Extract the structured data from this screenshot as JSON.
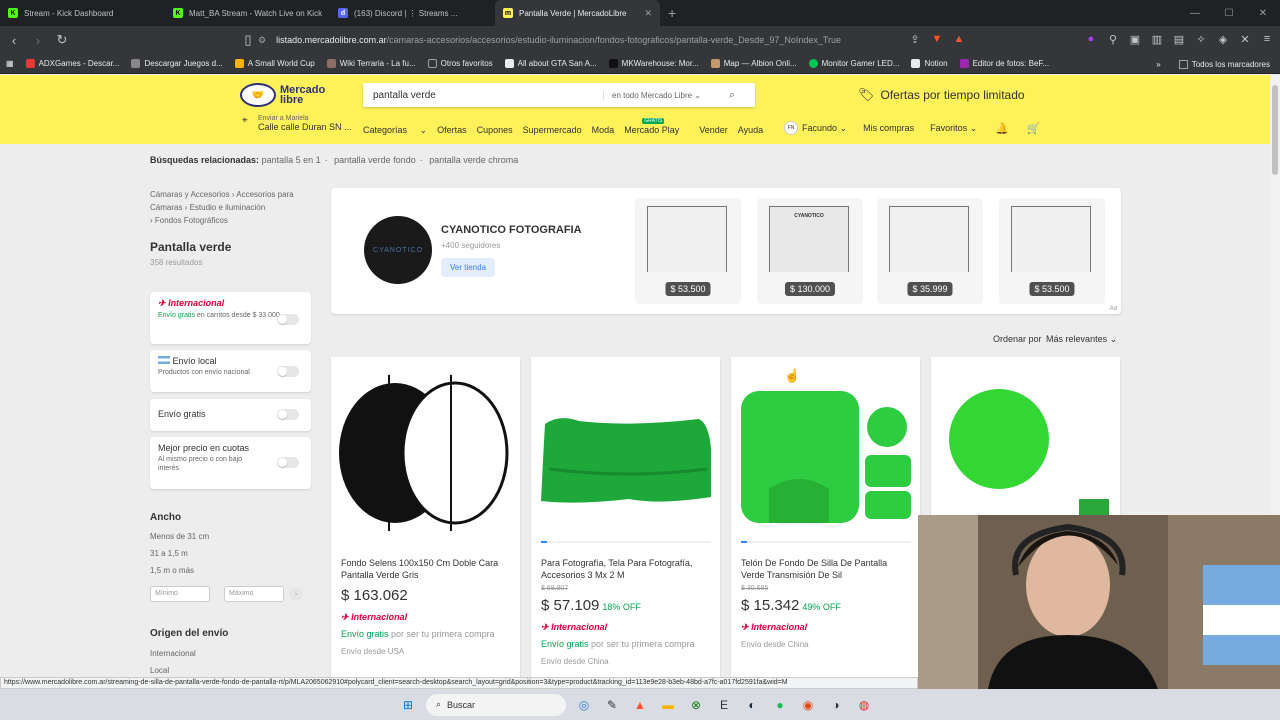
{
  "browser": {
    "tabs": [
      {
        "label": "Stream - Kick Dashboard",
        "fav_color": "#53fc18",
        "fav_glyph": "K"
      },
      {
        "label": "Matt_BA Stream - Watch Live on Kick",
        "fav_color": "#53fc18",
        "fav_glyph": "K"
      },
      {
        "label": "(163) Discord | ⋮ Streams ...",
        "fav_color": "#5865f2",
        "fav_glyph": "d"
      },
      {
        "label": "Pantalla Verde | MercadoLibre",
        "fav_color": "#fff159",
        "fav_glyph": "m"
      }
    ],
    "new_tab": "+",
    "url_host": "listado.mercadolibre.com.ar",
    "url_path": "/camaras-accesorios/accesorios/estudio-iluminacion/fondos-fotograficos/pantalla-verde_Desde_97_NoIndex_True",
    "bookmarks": [
      {
        "label": "ADXGames - Descar...",
        "color": "#e53935"
      },
      {
        "label": "Descargar Juegos d...",
        "color": "#888888"
      },
      {
        "label": "A Small World Cup",
        "color": "#ffb300"
      },
      {
        "label": "Wiki Terraria - La fu...",
        "color": "#8d6e63"
      },
      {
        "label": "Otros favoritos",
        "color": "#9aa0a6"
      },
      {
        "label": "All about GTA San A...",
        "color": "#e8eaed"
      },
      {
        "label": "MKWarehouse: Mor...",
        "color": "#333333"
      },
      {
        "label": "Map — Albion Onli...",
        "color": "#c49a6c"
      },
      {
        "label": "Monitor Gamer LED...",
        "color": "#00c853"
      },
      {
        "label": "Notion",
        "color": "#e8eaed"
      },
      {
        "label": "Editor de fotos: BeF...",
        "color": "#9c27b0"
      }
    ],
    "bookmarks_right": "Todos los marcadores"
  },
  "header": {
    "logo_text_1": "Mercado",
    "logo_text_2": "libre",
    "search_value": "pantalla verde",
    "search_scope": "en todo Mercado Libre",
    "offers": "Ofertas por tiempo limitado",
    "ship_l1": "Enviar a Mariela",
    "ship_l2": "Calle calle Duran SN ...",
    "nav": [
      "Categorías",
      "Ofertas",
      "Cupones",
      "Supermercado",
      "Moda",
      "Mercado Play",
      "Vender",
      "Ayuda"
    ],
    "gratis_badge": "GRATIS",
    "user": "Facundo",
    "user_initials": "FN",
    "purchases": "Mis compras",
    "favorites": "Favoritos"
  },
  "related": {
    "label": "Búsquedas relacionadas:",
    "items": [
      "pantalla 5 en 1",
      "pantalla verde fondo",
      "pantalla verde chroma"
    ]
  },
  "breadcrumb": {
    "l1": "Cámaras y Accesorios",
    "l2": "Accesorios para Cámaras",
    "l3": "Estudio e iluminación",
    "l4": "Fondos Fotográficos"
  },
  "results": {
    "title": "Pantalla verde",
    "count": "358 resultados"
  },
  "filters": {
    "intl_title": "Internacional",
    "intl_sub_green": "Envío gratis",
    "intl_sub_rest": "en carritos desde $ 33.000",
    "local_title": "Envío local",
    "local_sub": "Productos con envío nacional",
    "free_title": "Envío gratis",
    "cuotas_title": "Mejor precio en cuotas",
    "cuotas_sub": "Al mismo precio o con bajo interés"
  },
  "sidebar": {
    "ancho_title": "Ancho",
    "ancho_options": [
      "Menos de 31 cm",
      "31 a 1,5 m",
      "1,5 m o más"
    ],
    "min_placeholder": "Mínimo",
    "max_placeholder": "Máximo",
    "origin_title": "Origen del envío",
    "origin_options": [
      "Internacional",
      "Local"
    ]
  },
  "store": {
    "logo_text": "CYANOTICO",
    "name": "CYANOTICO FOTOGRAFIA",
    "followers": "+400 seguidores",
    "button": "Ver tienda",
    "ad": "Ad",
    "products": [
      {
        "price": "$ 53.500",
        "mark": ""
      },
      {
        "price": "$ 130.000",
        "mark": "CYANOTICO"
      },
      {
        "price": "$ 35.999",
        "mark": ""
      },
      {
        "price": "$ 53.500",
        "mark": ""
      }
    ]
  },
  "sort": {
    "label": "Ordenar por",
    "value": "Más relevantes"
  },
  "products": [
    {
      "title": "Fondo Selens 100x150 Cm Doble Cara Pantalla Verde Gris",
      "old": "",
      "price": "$ 163.062",
      "off": "",
      "intl": "Internacional",
      "free_green": "Envío gratis",
      "free_rest": "por ser tu primera compra",
      "from": "Envío desde USA"
    },
    {
      "title": "Para Fotografía, Tela Para Fotografía, Accesorios 3 Mx 2 M",
      "old": "$ 69.907",
      "price": "$ 57.109",
      "off": "18% OFF",
      "intl": "Internacional",
      "free_green": "Envío gratis",
      "free_rest": "por ser tu primera compra",
      "from": "Envío desde China"
    },
    {
      "title": "Telón De Fondo De Silla De Pantalla Verde Transmisión De Sil",
      "old": "$ 30.685",
      "price": "$ 15.342",
      "off": "49% OFF",
      "intl": "Internacional",
      "free_green": "",
      "free_rest": "",
      "from": "Envío desde China"
    },
    {
      "title": "",
      "old": "",
      "price": "",
      "off": "",
      "intl": "",
      "free_green": "",
      "free_rest": "",
      "from": ""
    }
  ],
  "status_url": "https://www.mercadolibre.com.ar/streaming-de-silla-de-pantalla-verde-fondo-de-pantalla-rt/p/MLA20650629​10#polycard_client=search-desktop&search_layout=grid&position=3&type=product&tracking_id=113e9e28-b3eb-48bd-a7fc-a017fd2591fa&wid=M",
  "taskbar": {
    "search": "Buscar"
  }
}
